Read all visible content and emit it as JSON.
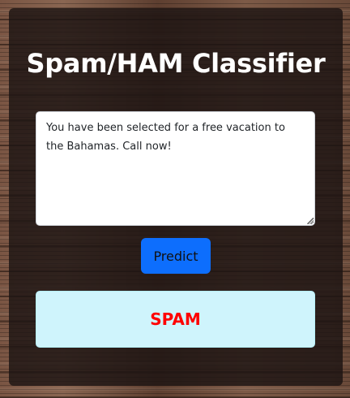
{
  "app": {
    "title": "Spam/HAM Classifier"
  },
  "form": {
    "message_value": "You have been selected for a free vacation to the Bahamas. Call now!",
    "predict_label": "Predict"
  },
  "result": {
    "label": "SPAM",
    "label_color": "#ff0000",
    "box_color": "#cff4fc"
  },
  "colors": {
    "primary_button": "#0d6efd",
    "card_overlay": "rgba(28,20,18,0.82)"
  }
}
